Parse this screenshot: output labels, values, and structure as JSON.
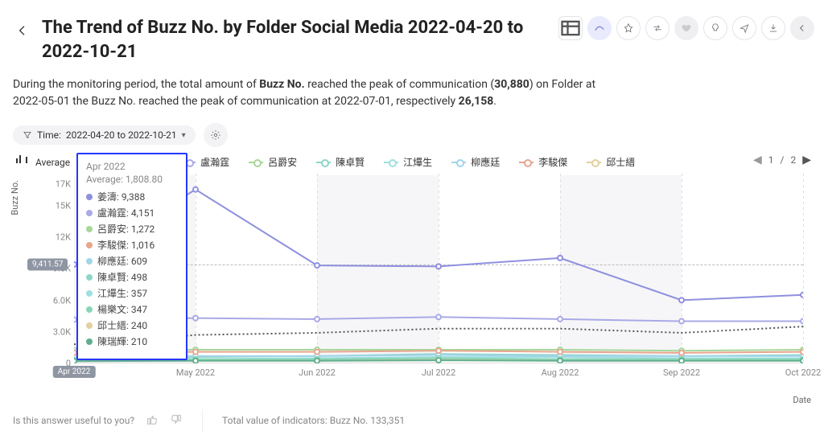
{
  "header": {
    "title": "The Trend of Buzz No. by Folder Social Media 2022-04-20 to 2022-10-21"
  },
  "description": {
    "p1_a": "During the monitoring period, the total amount of ",
    "p1_b": "Buzz No.",
    "p1_c": " reached the peak of communication (",
    "p1_d": "30,880",
    "p1_e": ") on Folder at 2022-05-01 the Buzz No. reached the peak of communication at 2022-07-01, respectively ",
    "p1_f": "26,158",
    "p1_g": "."
  },
  "filters": {
    "time_label": "Time:",
    "time_value": "2022-04-20 to 2022-10-21"
  },
  "legend": {
    "avg": "Average",
    "items": [
      {
        "label": "姜濤",
        "color": "#8f8fe0"
      },
      {
        "label": "盧瀚霆",
        "color": "#a9a9e7"
      },
      {
        "label": "呂爵安",
        "color": "#a7d79a"
      },
      {
        "label": "陳卓賢",
        "color": "#8fd6c9"
      },
      {
        "label": "江𤒹生",
        "color": "#9de0e0"
      },
      {
        "label": "柳應廷",
        "color": "#a2d4ea"
      },
      {
        "label": "李駿傑",
        "color": "#e7a58f"
      },
      {
        "label": "邱士縉",
        "color": "#e3cfa0"
      }
    ],
    "pager": {
      "cur": "1",
      "sep": "/",
      "tot": "2"
    }
  },
  "axes": {
    "ylabel": "Buzz No.",
    "xlabel": "Date",
    "yticks": [
      "17K",
      "15K",
      "12K",
      "9.0K",
      "6.0K",
      "3.0K",
      "0"
    ],
    "ytickvals": [
      17000,
      15000,
      12000,
      9000,
      6000,
      3000,
      0
    ],
    "xticks": [
      "May 2022",
      "Jun 2022",
      "Jul 2022",
      "Aug 2022",
      "Sep 2022",
      "Oct 2022"
    ]
  },
  "avg_badge": "9,411.57",
  "x_highlight": "Apr 2022",
  "tooltip": {
    "title": "Apr 2022",
    "avg_label": "Average: 1,808.80",
    "rows": [
      {
        "color": "#8f8fe0",
        "label": "姜濤: 9,388"
      },
      {
        "color": "#a9a9e7",
        "label": "盧瀚霆: 4,151"
      },
      {
        "color": "#a7d79a",
        "label": "呂爵安: 1,272"
      },
      {
        "color": "#e7a58f",
        "label": "李駿傑: 1,016"
      },
      {
        "color": "#a2d4ea",
        "label": "柳應廷: 609"
      },
      {
        "color": "#8fd6c9",
        "label": "陳卓賢: 498"
      },
      {
        "color": "#9de0e0",
        "label": "江𤒹生: 357"
      },
      {
        "color": "#88d6b8",
        "label": "楊樂文: 347"
      },
      {
        "color": "#e3cfa0",
        "label": "邱士縉: 240"
      },
      {
        "color": "#5fae8e",
        "label": "陳瑞輝: 210"
      }
    ]
  },
  "footer": {
    "useful": "Is this answer useful to you?",
    "total": "Total value of indicators: Buzz No. 133,351"
  },
  "chart_data": {
    "type": "line",
    "title": "The Trend of Buzz No. by Folder Social Media 2022-04-20 to 2022-10-21",
    "xlabel": "Date",
    "ylabel": "Buzz No.",
    "ylim": [
      0,
      18000
    ],
    "x": [
      "Apr 2022",
      "May 2022",
      "Jun 2022",
      "Jul 2022",
      "Aug 2022",
      "Sep 2022",
      "Oct 2022"
    ],
    "average_reference": 9411.57,
    "series": [
      {
        "name": "Average (dotted)",
        "style": "dotted",
        "values": [
          1809,
          2700,
          2900,
          3300,
          3300,
          2900,
          3500
        ]
      },
      {
        "name": "姜濤",
        "color": "#8f8fe0",
        "values": [
          9388,
          16500,
          9300,
          9200,
          10000,
          6000,
          6500
        ]
      },
      {
        "name": "盧瀚霆",
        "color": "#a9a9e7",
        "values": [
          4151,
          4300,
          4200,
          4400,
          4200,
          4000,
          4000
        ]
      },
      {
        "name": "呂爵安",
        "color": "#a7d79a",
        "values": [
          1272,
          1300,
          1300,
          1300,
          1300,
          1200,
          1300
        ]
      },
      {
        "name": "陳卓賢",
        "color": "#8fd6c9",
        "values": [
          498,
          600,
          700,
          900,
          800,
          700,
          800
        ]
      },
      {
        "name": "江𤒹生",
        "color": "#9de0e0",
        "values": [
          357,
          400,
          500,
          600,
          600,
          500,
          500
        ]
      },
      {
        "name": "柳應廷",
        "color": "#a2d4ea",
        "values": [
          609,
          700,
          700,
          800,
          700,
          700,
          700
        ]
      },
      {
        "name": "李駿傑",
        "color": "#e7a58f",
        "values": [
          1016,
          1100,
          1100,
          1200,
          1100,
          1000,
          1100
        ]
      },
      {
        "name": "邱士縉",
        "color": "#e3cfa0",
        "values": [
          240,
          300,
          300,
          400,
          300,
          300,
          300
        ]
      },
      {
        "name": "楊樂文",
        "color": "#88d6b8",
        "values": [
          347,
          400,
          400,
          500,
          400,
          400,
          400
        ]
      },
      {
        "name": "陳瑞輝",
        "color": "#5fae8e",
        "values": [
          210,
          250,
          250,
          300,
          250,
          250,
          250
        ]
      }
    ]
  }
}
